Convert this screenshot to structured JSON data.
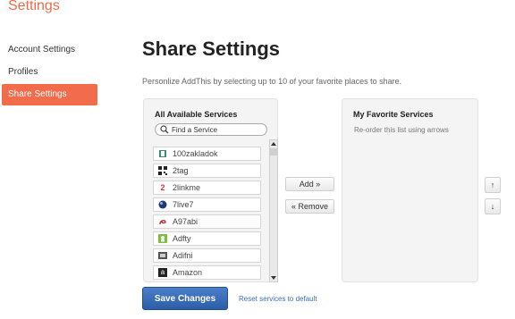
{
  "app": {
    "title": "Settings"
  },
  "sidebar": {
    "items": [
      {
        "label": "Account Settings"
      },
      {
        "label": "Profiles"
      },
      {
        "label": "Share Settings"
      }
    ]
  },
  "main": {
    "title": "Share Settings",
    "subtitle": "Personlize AddThis by selecting up to 10 of your favorite places to share."
  },
  "available": {
    "heading": "All Available Services",
    "search_placeholder": "Find a Service",
    "services": [
      {
        "label": "100zakladok",
        "icon": "bookmark-icon"
      },
      {
        "label": "2tag",
        "icon": "qr-code-icon"
      },
      {
        "label": "2linkme",
        "icon": "number-two-icon"
      },
      {
        "label": "7live7",
        "icon": "globe-icon"
      },
      {
        "label": "A97abi",
        "icon": "a97abi-logo-icon"
      },
      {
        "label": "Adfty",
        "icon": "adfty-logo-icon"
      },
      {
        "label": "Adifni",
        "icon": "adifni-logo-icon"
      },
      {
        "label": "Amazon",
        "icon": "amazon-logo-icon"
      }
    ]
  },
  "favorites": {
    "heading": "My Favorite Services",
    "hint": "Re-order this list using arrows"
  },
  "buttons": {
    "add": "Add »",
    "remove": "« Remove",
    "up": "↑",
    "down": "↓",
    "save": "Save Changes",
    "reset": "Reset services to default"
  },
  "colors": {
    "accent": "#f26b4b",
    "primary": "#2c5ea8",
    "link": "#3a6fbd"
  }
}
